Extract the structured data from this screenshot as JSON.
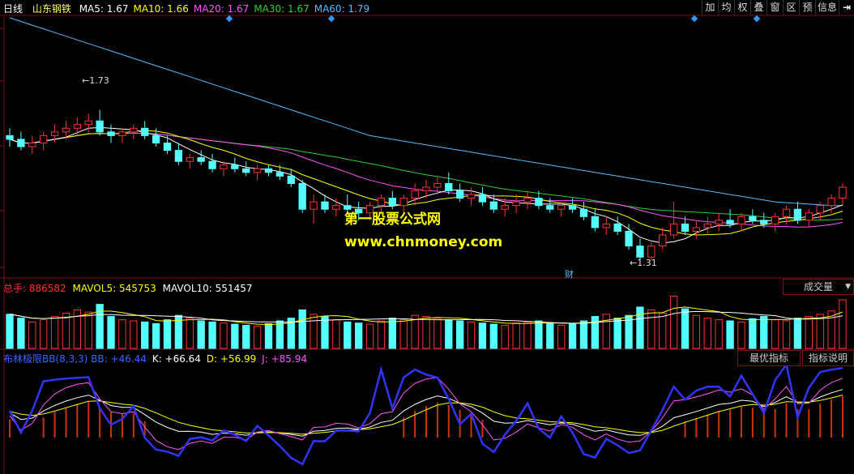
{
  "header": {
    "period": "日线",
    "stock_name": "山东钢铁",
    "ma": [
      {
        "label": "MA5:",
        "value": "1.67",
        "color": "#ffffff"
      },
      {
        "label": "MA10:",
        "value": "1.66",
        "color": "#ffff00"
      },
      {
        "label": "MA20:",
        "value": "1.67",
        "color": "#ff55ff"
      },
      {
        "label": "MA30:",
        "value": "1.67",
        "color": "#33cc33"
      },
      {
        "label": "MA60:",
        "value": "1.79",
        "color": "#55bbff"
      }
    ]
  },
  "toolbar": {
    "buttons": [
      "加",
      "均",
      "权",
      "叠",
      "窗",
      "区",
      "预",
      "信息"
    ]
  },
  "price_panel": {
    "high_label": "1.73",
    "low_label": "1.31",
    "finance_marker": "财"
  },
  "volume_panel": {
    "total_label": "总手:",
    "total_value": "886582",
    "mavol5_label": "MAVOL5:",
    "mavol5_value": "545753",
    "mavol10_label": "MAVOL10:",
    "mavol10_value": "551457",
    "selector": "成交量"
  },
  "indicator_panel": {
    "name": "布林极限BB(8,3,3) BB:",
    "bb_value": "+46.44",
    "k_label": "K:",
    "k_value": "+66.64",
    "d_label": "D:",
    "d_value": "+56.99",
    "j_label": "J:",
    "j_value": "+85.94",
    "best_button": "最优指标",
    "explain_button": "指标说明"
  },
  "watermark": {
    "line1": "第一股票公式网",
    "line2": "www.chnmoney.com"
  },
  "colors": {
    "up": "#ff3333",
    "down": "#54ffff",
    "ma5": "#ffffff",
    "ma10": "#ffff00",
    "ma20": "#ff55ff",
    "ma30": "#33cc33",
    "ma60": "#55bbff",
    "bb_line": "#3333ff",
    "grid": "#7a1010"
  },
  "chart_data": {
    "type": "candlestick",
    "price_range": [
      1.28,
      1.98
    ],
    "candles": [
      [
        1.66,
        1.68,
        1.63,
        1.65
      ],
      [
        1.65,
        1.67,
        1.62,
        1.63
      ],
      [
        1.63,
        1.66,
        1.61,
        1.64
      ],
      [
        1.64,
        1.67,
        1.62,
        1.66
      ],
      [
        1.66,
        1.69,
        1.64,
        1.67
      ],
      [
        1.67,
        1.7,
        1.65,
        1.68
      ],
      [
        1.68,
        1.71,
        1.66,
        1.69
      ],
      [
        1.69,
        1.72,
        1.67,
        1.7
      ],
      [
        1.7,
        1.73,
        1.66,
        1.67
      ],
      [
        1.67,
        1.69,
        1.64,
        1.66
      ],
      [
        1.66,
        1.68,
        1.64,
        1.67
      ],
      [
        1.67,
        1.69,
        1.65,
        1.68
      ],
      [
        1.68,
        1.7,
        1.65,
        1.66
      ],
      [
        1.66,
        1.68,
        1.63,
        1.64
      ],
      [
        1.64,
        1.66,
        1.61,
        1.62
      ],
      [
        1.62,
        1.64,
        1.58,
        1.59
      ],
      [
        1.59,
        1.61,
        1.57,
        1.6
      ],
      [
        1.6,
        1.62,
        1.58,
        1.59
      ],
      [
        1.59,
        1.61,
        1.56,
        1.57
      ],
      [
        1.57,
        1.59,
        1.55,
        1.58
      ],
      [
        1.58,
        1.6,
        1.56,
        1.57
      ],
      [
        1.57,
        1.59,
        1.55,
        1.56
      ],
      [
        1.56,
        1.58,
        1.54,
        1.57
      ],
      [
        1.57,
        1.58,
        1.55,
        1.56
      ],
      [
        1.56,
        1.58,
        1.54,
        1.55
      ],
      [
        1.55,
        1.57,
        1.52,
        1.53
      ],
      [
        1.53,
        1.54,
        1.45,
        1.46
      ],
      [
        1.46,
        1.5,
        1.42,
        1.48
      ],
      [
        1.48,
        1.5,
        1.45,
        1.46
      ],
      [
        1.46,
        1.49,
        1.44,
        1.47
      ],
      [
        1.47,
        1.5,
        1.45,
        1.46
      ],
      [
        1.46,
        1.48,
        1.43,
        1.45
      ],
      [
        1.45,
        1.48,
        1.43,
        1.47
      ],
      [
        1.47,
        1.5,
        1.45,
        1.49
      ],
      [
        1.49,
        1.51,
        1.46,
        1.47
      ],
      [
        1.47,
        1.5,
        1.45,
        1.49
      ],
      [
        1.49,
        1.53,
        1.47,
        1.51
      ],
      [
        1.51,
        1.54,
        1.49,
        1.52
      ],
      [
        1.52,
        1.55,
        1.5,
        1.53
      ],
      [
        1.53,
        1.56,
        1.5,
        1.51
      ],
      [
        1.51,
        1.53,
        1.48,
        1.49
      ],
      [
        1.49,
        1.52,
        1.47,
        1.5
      ],
      [
        1.5,
        1.52,
        1.47,
        1.48
      ],
      [
        1.48,
        1.5,
        1.45,
        1.46
      ],
      [
        1.46,
        1.49,
        1.44,
        1.47
      ],
      [
        1.47,
        1.5,
        1.45,
        1.48
      ],
      [
        1.48,
        1.51,
        1.46,
        1.49
      ],
      [
        1.49,
        1.51,
        1.46,
        1.47
      ],
      [
        1.47,
        1.49,
        1.45,
        1.46
      ],
      [
        1.46,
        1.48,
        1.44,
        1.47
      ],
      [
        1.47,
        1.49,
        1.45,
        1.46
      ],
      [
        1.46,
        1.48,
        1.43,
        1.44
      ],
      [
        1.44,
        1.46,
        1.4,
        1.41
      ],
      [
        1.41,
        1.44,
        1.39,
        1.42
      ],
      [
        1.42,
        1.44,
        1.39,
        1.4
      ],
      [
        1.4,
        1.42,
        1.35,
        1.36
      ],
      [
        1.36,
        1.38,
        1.31,
        1.33
      ],
      [
        1.33,
        1.37,
        1.32,
        1.36
      ],
      [
        1.36,
        1.41,
        1.35,
        1.39
      ],
      [
        1.39,
        1.48,
        1.38,
        1.42
      ],
      [
        1.42,
        1.44,
        1.39,
        1.4
      ],
      [
        1.4,
        1.43,
        1.38,
        1.41
      ],
      [
        1.41,
        1.44,
        1.39,
        1.42
      ],
      [
        1.42,
        1.45,
        1.4,
        1.43
      ],
      [
        1.43,
        1.46,
        1.41,
        1.42
      ],
      [
        1.42,
        1.45,
        1.4,
        1.44
      ],
      [
        1.44,
        1.46,
        1.42,
        1.43
      ],
      [
        1.43,
        1.45,
        1.41,
        1.42
      ],
      [
        1.42,
        1.45,
        1.4,
        1.44
      ],
      [
        1.44,
        1.47,
        1.42,
        1.46
      ],
      [
        1.46,
        1.48,
        1.42,
        1.43
      ],
      [
        1.43,
        1.46,
        1.41,
        1.45
      ],
      [
        1.45,
        1.48,
        1.43,
        1.47
      ],
      [
        1.47,
        1.5,
        1.45,
        1.49
      ],
      [
        1.49,
        1.53,
        1.47,
        1.52
      ]
    ],
    "volumes": [
      62,
      55,
      48,
      52,
      58,
      64,
      70,
      66,
      80,
      58,
      52,
      50,
      48,
      45,
      52,
      60,
      55,
      50,
      48,
      46,
      44,
      42,
      40,
      45,
      50,
      55,
      70,
      62,
      58,
      52,
      48,
      46,
      44,
      50,
      55,
      52,
      60,
      58,
      55,
      52,
      50,
      48,
      46,
      44,
      42,
      46,
      48,
      50,
      45,
      42,
      44,
      50,
      58,
      62,
      55,
      60,
      75,
      70,
      64,
      95,
      72,
      60,
      55,
      52,
      50,
      48,
      54,
      58,
      52,
      50,
      55,
      58,
      62,
      68,
      88
    ],
    "ma60": [
      1.98,
      1.97,
      1.96,
      1.95,
      1.94,
      1.93,
      1.92,
      1.91,
      1.9,
      1.89,
      1.88,
      1.87,
      1.86,
      1.85,
      1.84,
      1.83,
      1.82,
      1.81,
      1.8,
      1.79,
      1.78,
      1.77,
      1.76,
      1.75,
      1.74,
      1.73,
      1.72,
      1.71,
      1.7,
      1.69,
      1.68,
      1.67,
      1.66,
      1.655,
      1.65,
      1.645,
      1.64,
      1.635,
      1.63,
      1.625,
      1.62,
      1.615,
      1.61,
      1.605,
      1.6,
      1.595,
      1.59,
      1.585,
      1.58,
      1.575,
      1.57,
      1.565,
      1.56,
      1.555,
      1.55,
      1.545,
      1.54,
      1.535,
      1.53,
      1.525,
      1.52,
      1.515,
      1.51,
      1.505,
      1.5,
      1.495,
      1.49,
      1.485,
      1.48,
      1.478,
      1.476,
      1.474,
      1.472,
      1.47,
      1.47
    ]
  }
}
